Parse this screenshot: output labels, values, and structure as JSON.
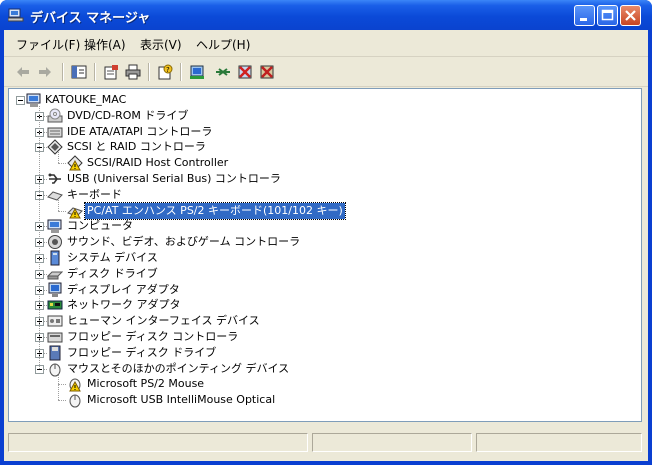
{
  "window": {
    "title": "デバイス マネージャ"
  },
  "menu": [
    "ファイル(F)",
    "操作(A)",
    "表示(V)",
    "ヘルプ(H)"
  ],
  "toolbar_icons": [
    "back-arrow-icon",
    "forward-arrow-icon",
    "show-hide-console-tree-icon",
    "properties-icon",
    "print-icon",
    "help-icon",
    "update-driver-icon",
    "disable-device-icon",
    "uninstall-icon",
    "scan-hardware-icon"
  ],
  "tree": {
    "root": "KATOUKE_MAC",
    "items": [
      {
        "label": "DVD/CD-ROM ドライブ",
        "state": "collapsed",
        "icon": "dvd-drive-icon"
      },
      {
        "label": "IDE ATA/ATAPI コントローラ",
        "state": "collapsed",
        "icon": "ide-controller-icon"
      },
      {
        "label": "SCSI と RAID コントローラ",
        "state": "expanded",
        "icon": "scsi-controller-icon",
        "children": [
          {
            "label": "SCSI/RAID Host Controller",
            "icon": "warning-device-icon"
          }
        ]
      },
      {
        "label": "USB (Universal Serial Bus) コントローラ",
        "state": "collapsed",
        "icon": "usb-icon"
      },
      {
        "label": "キーボード",
        "state": "expanded",
        "icon": "keyboard-icon",
        "children": [
          {
            "label": "PC/AT エンハンス PS/2 キーボード(101/102 キー)",
            "icon": "warning-keyboard-icon",
            "selected": true
          }
        ]
      },
      {
        "label": "コンピュータ",
        "state": "collapsed",
        "icon": "computer-icon"
      },
      {
        "label": "サウンド、ビデオ、およびゲーム コントローラ",
        "state": "collapsed",
        "icon": "sound-icon"
      },
      {
        "label": "システム デバイス",
        "state": "collapsed",
        "icon": "system-device-icon"
      },
      {
        "label": "ディスク ドライブ",
        "state": "collapsed",
        "icon": "disk-drive-icon"
      },
      {
        "label": "ディスプレイ アダプタ",
        "state": "collapsed",
        "icon": "display-adapter-icon"
      },
      {
        "label": "ネットワーク アダプタ",
        "state": "collapsed",
        "icon": "network-adapter-icon"
      },
      {
        "label": "ヒューマン インターフェイス デバイス",
        "state": "collapsed",
        "icon": "hid-icon"
      },
      {
        "label": "フロッピー ディスク コントローラ",
        "state": "collapsed",
        "icon": "floppy-controller-icon"
      },
      {
        "label": "フロッピー ディスク ドライブ",
        "state": "collapsed",
        "icon": "floppy-drive-icon"
      },
      {
        "label": "マウスとそのほかのポインティング デバイス",
        "state": "expanded",
        "icon": "mouse-icon",
        "children": [
          {
            "label": "Microsoft PS/2 Mouse",
            "icon": "warning-mouse-icon"
          },
          {
            "label": "Microsoft USB IntelliMouse Optical",
            "icon": "mouse-icon"
          }
        ]
      }
    ]
  },
  "colors": {
    "selection": "#316ac5",
    "title_bar": "#0a4ad8",
    "window_bg": "#ece9d8"
  }
}
